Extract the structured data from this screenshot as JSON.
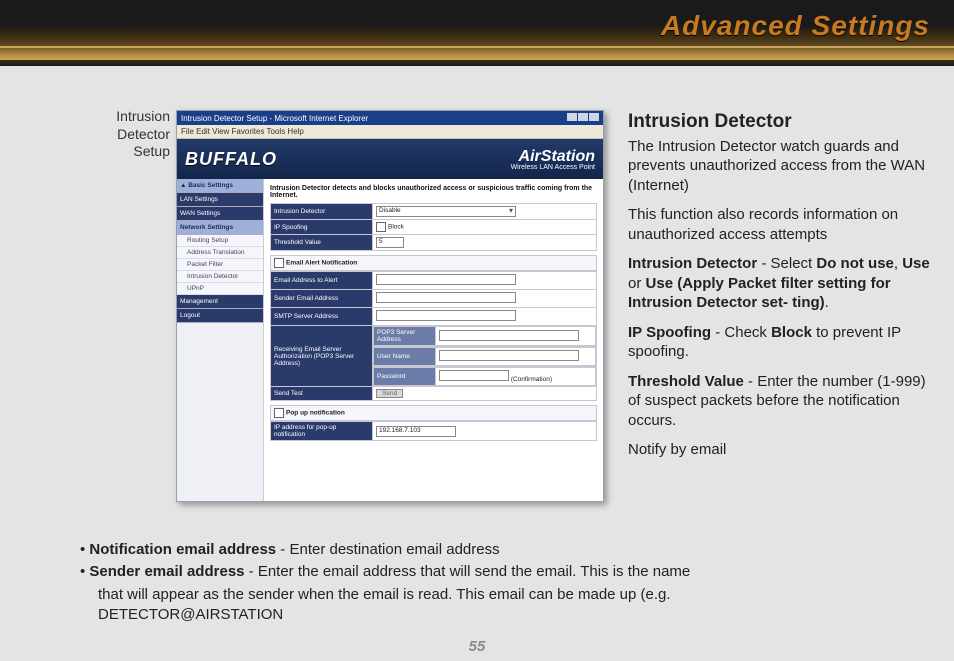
{
  "page_title": "Advanced Settings",
  "page_number": "55",
  "caption": "Intrusion Detector Setup",
  "browser": {
    "title": "Intrusion Detector Setup - Microsoft Internet Explorer",
    "menus": "File   Edit   View   Favorites   Tools   Help"
  },
  "brand": {
    "left": "BUFFALO",
    "right_big": "AirStation",
    "right_small": "Wireless LAN Access Point"
  },
  "sidebar": {
    "basic": "▲ Basic Settings",
    "lan": "LAN Settings",
    "wan": "WAN Settings",
    "net": "Network Settings",
    "subs": [
      "Routing Setup",
      "Address Translation",
      "Packet Filter",
      "Intrusion Detector",
      "UPnP"
    ],
    "mgmt": "Management",
    "logout": "Logout"
  },
  "form": {
    "desc": "Intrusion Detector detects and blocks unauthorized access or suspicious traffic coming from the Internet.",
    "rows": {
      "intrusion": {
        "label": "Intrusion Detector",
        "value": "Disable"
      },
      "ipspoof": {
        "label": "IP Spoofing",
        "value": "Block"
      },
      "threshold": {
        "label": "Threshold Value",
        "value": "5"
      }
    },
    "email_section": "Email Alert Notification",
    "email_rows": {
      "to": {
        "label": "Email Address to Alert"
      },
      "from": {
        "label": "Sender Email Address"
      },
      "smtp": {
        "label": "SMTP Server Address"
      }
    },
    "auth": {
      "group": "Receiving Email Server Authorization (POP3 Server Address)",
      "pop3": "POP3 Server Address",
      "user": "User Name",
      "pass": "Password",
      "confirm": "(Confirmation)"
    },
    "send_test": {
      "label": "Send Test",
      "btn": "Send"
    },
    "popup": "Pop up notification",
    "popup_ip": {
      "label": "IP address for pop-up notification",
      "value": "192.168.7.103"
    }
  },
  "right": {
    "h": "Intrusion Detector",
    "p1": "The Intrusion Detector watch guards and prevents unauthorized access from the WAN (Internet)",
    "p2": "This function also records information on unauthorized access attempts",
    "b1a": "Intrusion Detector",
    "b1b": " - Select ",
    "b1c": "Do not use",
    "b1d": ", ",
    "b1e": "Use",
    "b1f": " or ",
    "b1g": "Use (Apply Packet filter setting for Intrusion Detector set- ting)",
    "b1h": ".",
    "b2a": "IP Spoofing",
    "b2b": " - Check ",
    "b2c": "Block",
    "b2d": " to prevent IP spoofing.",
    "b3a": "Threshold Value",
    "b3b": " - Enter the number (1-999) of suspect packets before the notification occurs.",
    "b4": "Notify by email"
  },
  "bottom": {
    "l1a": "• ",
    "l1b": "Notification email address",
    "l1c": " - Enter destination email address",
    "l2a": "• ",
    "l2b": "Sender email address",
    "l2c": " - Enter the email address that will send the email.  This is the name",
    "l3": "that will appear as the sender when the email is read.  This email can be made up (e.g.",
    "l4": "DETECTOR@AIRSTATION"
  }
}
